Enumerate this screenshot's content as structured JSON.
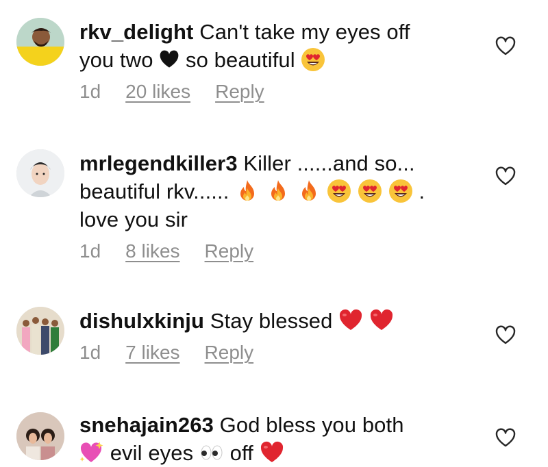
{
  "comments": [
    {
      "username": "rkv_delight",
      "text_a": "Can't take my eyes off",
      "text_b": "you two",
      "text_c": "so beautiful",
      "time": "1d",
      "likes": "20 likes",
      "reply": "Reply"
    },
    {
      "username": "mrlegendkiller3",
      "text_a": "Killer ......and so...",
      "text_b": "beautiful rkv......",
      "text_c": ".",
      "text_d": "love you sir",
      "time": "1d",
      "likes": "8 likes",
      "reply": "Reply"
    },
    {
      "username": "dishulxkinju",
      "text_a": "Stay blessed",
      "time": "1d",
      "likes": "7 likes",
      "reply": "Reply"
    },
    {
      "username": "snehajain263",
      "text_a": "God bless you both",
      "text_b": "evil eyes",
      "text_c": "off"
    }
  ],
  "icons": {
    "like": "heart-outline-icon",
    "black_heart": "black-heart-emoji",
    "heart_eyes": "heart-eyes-emoji",
    "fire": "fire-emoji",
    "red_heart": "red-heart-emoji",
    "sparkling_heart": "sparkling-heart-emoji",
    "eyes": "eyes-emoji"
  },
  "colors": {
    "meta_text": "#8e8e8e",
    "red_heart": "#e0252f",
    "emoji_yellow": "#f9c43a"
  }
}
